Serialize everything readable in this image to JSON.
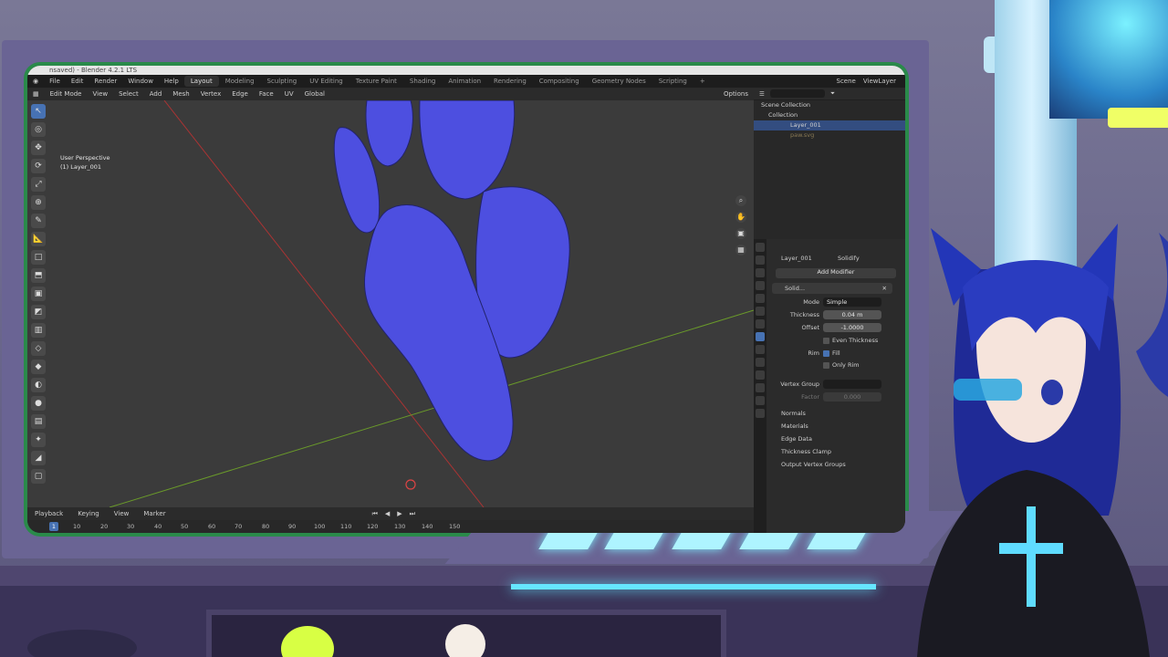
{
  "window": {
    "title": "nsaved) - Blender 4.2.1 LTS"
  },
  "menu": [
    "File",
    "Edit",
    "Render",
    "Window",
    "Help"
  ],
  "workspaces": {
    "active": "Layout",
    "others": [
      "Modeling",
      "Sculpting",
      "UV Editing",
      "Texture Paint",
      "Shading",
      "Animation",
      "Rendering",
      "Compositing",
      "Geometry Nodes",
      "Scripting"
    ]
  },
  "scene": {
    "scene_label": "Scene",
    "view_layer_label": "ViewLayer"
  },
  "viewport_header": {
    "mode": "Edit Mode",
    "menus": [
      "View",
      "Select",
      "Add",
      "Mesh",
      "Vertex",
      "Edge",
      "Face",
      "UV"
    ],
    "orientation": "Global",
    "options_label": "Options"
  },
  "viewport": {
    "perspective": "User Perspective",
    "object": "(1) Layer_001"
  },
  "timeline": {
    "menus": [
      "Playback",
      "Keying",
      "View",
      "Marker"
    ],
    "current_frame": "1",
    "ticks": [
      "10",
      "20",
      "30",
      "40",
      "50",
      "60",
      "70",
      "80",
      "90",
      "100",
      "110",
      "120",
      "130",
      "140",
      "150"
    ]
  },
  "outliner": {
    "search_placeholder": "",
    "scene_collection": "Scene Collection",
    "collection": "Collection",
    "items": [
      "Layer_001",
      "paw.svg"
    ]
  },
  "properties": {
    "breadcrumb_object": "Layer_001",
    "breadcrumb_modifier": "Solidify",
    "add_modifier": "Add Modifier",
    "modifier_name": "Solid...",
    "mode_label": "Mode",
    "mode_value": "Simple",
    "thickness_label": "Thickness",
    "thickness_value": "0.04 m",
    "offset_label": "Offset",
    "offset_value": "-1.0000",
    "even_thickness": "Even Thickness",
    "rim_label": "Rim",
    "fill_label": "Fill",
    "only_rim": "Only Rim",
    "vertex_group_label": "Vertex Group",
    "factor_label": "Factor",
    "factor_value": "0.000",
    "subpanels": [
      "Normals",
      "Materials",
      "Edge Data",
      "Thickness Clamp",
      "Output Vertex Groups"
    ]
  },
  "colors": {
    "accent": "#4772b3",
    "mesh": "#4d4fe0",
    "frame_glow": "#aef4ff"
  }
}
